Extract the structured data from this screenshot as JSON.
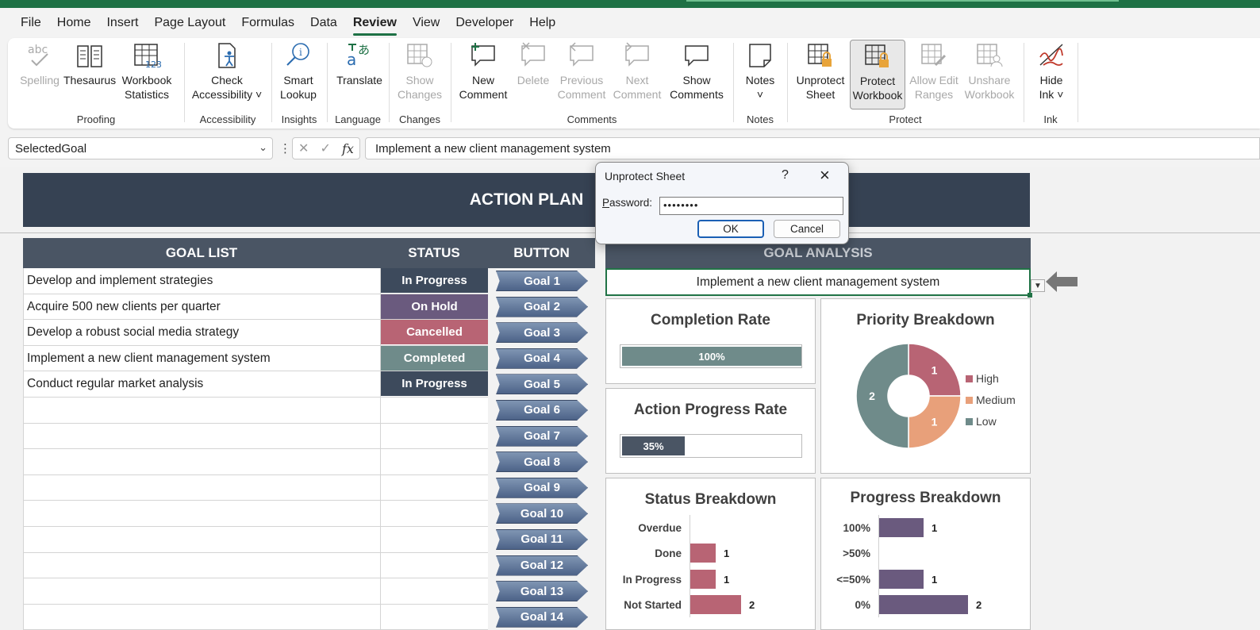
{
  "menu": [
    "File",
    "Home",
    "Insert",
    "Page Layout",
    "Formulas",
    "Data",
    "Review",
    "View",
    "Developer",
    "Help"
  ],
  "ribbon": {
    "groups": {
      "proofing": "Proofing",
      "accessibility": "Accessibility",
      "insights": "Insights",
      "language": "Language",
      "changes": "Changes",
      "comments": "Comments",
      "notes": "Notes",
      "protect": "Protect",
      "ink": "Ink"
    },
    "buttons": {
      "spelling": "Spelling",
      "thesaurus": "Thesaurus",
      "workbook_statistics_1": "Workbook",
      "workbook_statistics_2": "Statistics",
      "check_accessibility_1": "Check",
      "check_accessibility_2": "Accessibility ˅",
      "smart_lookup_1": "Smart",
      "smart_lookup_2": "Lookup",
      "translate": "Translate",
      "show_changes_1": "Show",
      "show_changes_2": "Changes",
      "new_comment_1": "New",
      "new_comment_2": "Comment",
      "delete": "Delete",
      "previous_comment_1": "Previous",
      "previous_comment_2": "Comment",
      "next_comment_1": "Next",
      "next_comment_2": "Comment",
      "show_comments_1": "Show",
      "show_comments_2": "Comments",
      "notes_1": "Notes",
      "notes_2": "˅",
      "unprotect_sheet_1": "Unprotect",
      "unprotect_sheet_2": "Sheet",
      "protect_workbook_1": "Protect",
      "protect_workbook_2": "Workbook",
      "allow_edit_ranges_1": "Allow Edit",
      "allow_edit_ranges_2": "Ranges",
      "unshare_workbook_1": "Unshare",
      "unshare_workbook_2": "Workbook",
      "hide_ink_1": "Hide",
      "hide_ink_2": "Ink ˅"
    }
  },
  "formula_bar": {
    "name_box": "SelectedGoal",
    "formula": "Implement a new client management system"
  },
  "sheet": {
    "title": "ACTION PLAN",
    "headers": {
      "goal_list": "GOAL LIST",
      "status": "STATUS",
      "button": "BUTTON",
      "goal_analysis": "GOAL ANALYSIS"
    },
    "goals": [
      {
        "text": "Develop and implement strategies",
        "status": "In Progress",
        "color": "#3d4a5c"
      },
      {
        "text": "Acquire 500 new clients per quarter",
        "status": "On Hold",
        "color": "#6a5a7e"
      },
      {
        "text": "Develop a robust social media strategy",
        "status": "Cancelled",
        "color": "#b86474"
      },
      {
        "text": "Implement a new client management system",
        "status": "Completed",
        "color": "#6f8b8a"
      },
      {
        "text": "Conduct regular market analysis",
        "status": "In Progress",
        "color": "#3d4a5c"
      }
    ],
    "empty_rows": 9,
    "goal_buttons": [
      "Goal 1",
      "Goal 2",
      "Goal 3",
      "Goal 4",
      "Goal 5",
      "Goal 6",
      "Goal 7",
      "Goal 8",
      "Goal 9",
      "Goal 10",
      "Goal 11",
      "Goal 12",
      "Goal 13",
      "Goal 14"
    ],
    "selected_goal": "Implement a new client management system",
    "completion_rate": {
      "title": "Completion Rate",
      "value": 100,
      "label": "100%",
      "color": "#6f8b8a"
    },
    "action_progress": {
      "title": "Action Progress Rate",
      "value": 35,
      "label": "35%",
      "color": "#4a5564"
    }
  },
  "chart_data": [
    {
      "type": "pie",
      "title": "Priority Breakdown",
      "categories": [
        "High",
        "Medium",
        "Low"
      ],
      "values": [
        1,
        1,
        2
      ],
      "colors": [
        "#b86474",
        "#e8a07a",
        "#6f8b8a"
      ],
      "legend": "right"
    },
    {
      "type": "bar",
      "title": "Status Breakdown",
      "categories": [
        "Overdue",
        "Done",
        "In Progress",
        "Not Started"
      ],
      "values": [
        0,
        1,
        1,
        2
      ],
      "labels": [
        "",
        "1",
        "1",
        "2"
      ],
      "color": "#b86474"
    },
    {
      "type": "bar",
      "title": "Progress Breakdown",
      "categories": [
        "100%",
        ">50%",
        "<=50%",
        "0%"
      ],
      "values": [
        1,
        0,
        1,
        2
      ],
      "labels": [
        "1",
        "",
        "1",
        "2"
      ],
      "color": "#6a5a7e"
    }
  ],
  "dialog": {
    "title": "Unprotect Sheet",
    "help": "?",
    "password_label": "Password:",
    "password_value": "••••••••",
    "ok": "OK",
    "cancel": "Cancel"
  }
}
